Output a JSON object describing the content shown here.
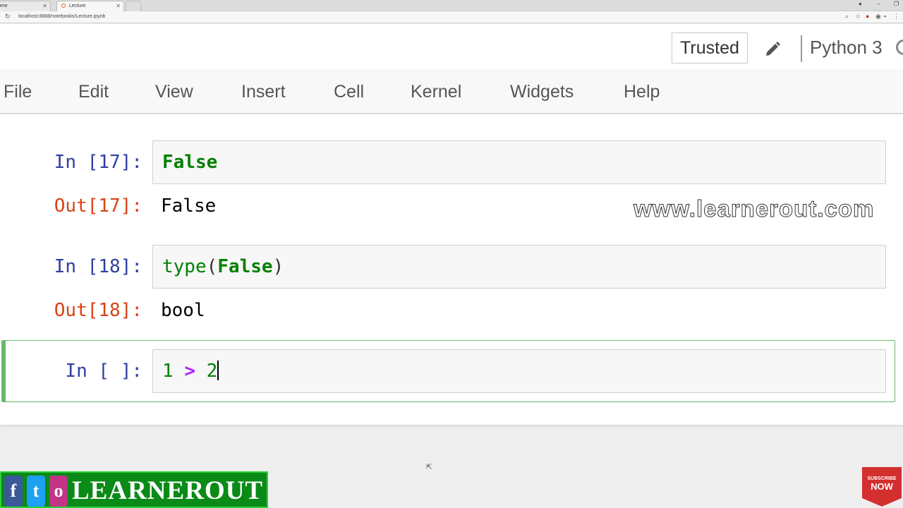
{
  "browser": {
    "tabs": [
      {
        "label": "ome",
        "active": false
      },
      {
        "label": "Lecture",
        "active": true
      }
    ],
    "url": "localhost:8888/notebooks/Lecture.ipynb"
  },
  "header": {
    "trusted_label": "Trusted",
    "kernel_name": "Python 3"
  },
  "menu": [
    "File",
    "Edit",
    "View",
    "Insert",
    "Cell",
    "Kernel",
    "Widgets",
    "Help"
  ],
  "cells": [
    {
      "in_prompt": "In [17]:",
      "out_prompt": "Out[17]:",
      "output": "False"
    },
    {
      "in_prompt": "In [18]:",
      "out_prompt": "Out[18]:",
      "output": "bool"
    },
    {
      "in_prompt": "In [ ]:"
    }
  ],
  "code": {
    "cell1": {
      "kw": "False"
    },
    "cell2": {
      "fn": "type",
      "open": "(",
      "kw": "False",
      "close": ")"
    },
    "cell3": {
      "a": "1",
      "op": ">",
      "b": "2"
    }
  },
  "watermark": "www.learnerout.com",
  "brand": {
    "name": "LEARNEROUT",
    "social": [
      "f",
      "t",
      "o"
    ],
    "subscribe": "SUBSCRIBE NOW",
    "colors": {
      "banner": "#0a8a17",
      "subscribe": "#d32f2f"
    }
  },
  "colors": {
    "in_prompt": "#303f9f",
    "out_prompt": "#d84315",
    "selected_border": "#66bb6a"
  }
}
